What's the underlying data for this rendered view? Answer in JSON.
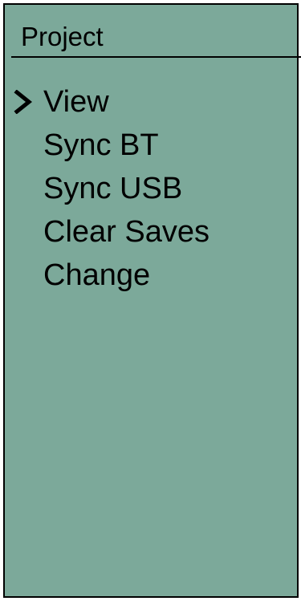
{
  "header": {
    "title": "Project"
  },
  "menu": {
    "selected_index": 0,
    "items": [
      {
        "label": "View"
      },
      {
        "label": "Sync BT"
      },
      {
        "label": "Sync USB"
      },
      {
        "label": "Clear Saves"
      },
      {
        "label": "Change"
      }
    ]
  },
  "colors": {
    "screen_background": "#7ca99a",
    "text": "#000000",
    "border": "#000000"
  },
  "icons": {
    "cursor": "chevron-right-icon"
  }
}
